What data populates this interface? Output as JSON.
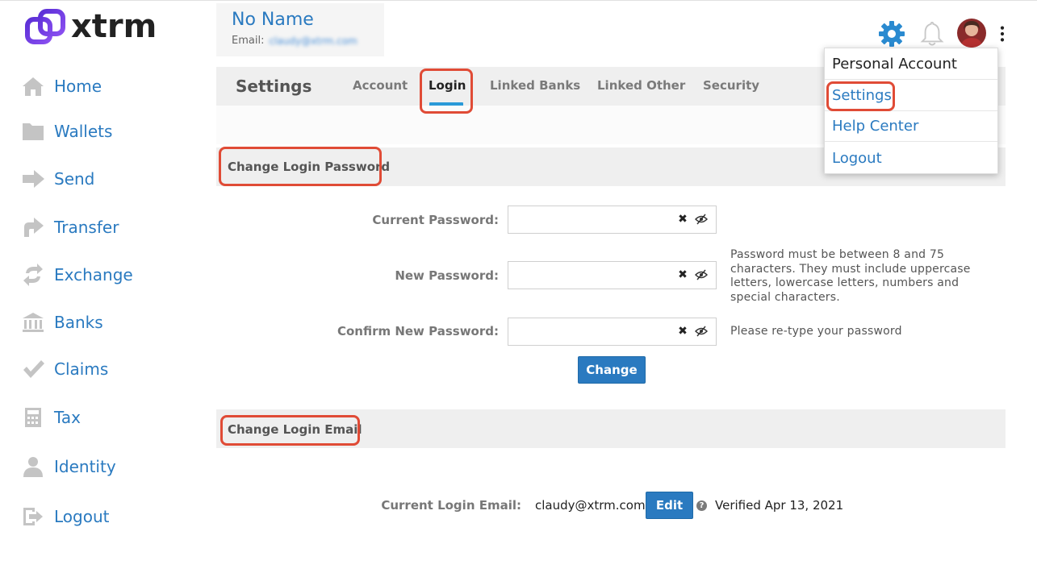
{
  "brand": {
    "logo_text": "xtrm",
    "colors": {
      "accent": "#2a7ac0",
      "logo_purple": "#6a3de8",
      "highlight": "#e04b36",
      "tab_underline": "#2a9ad8"
    }
  },
  "sidebar": {
    "items": [
      {
        "label": "Home",
        "icon": "home-icon"
      },
      {
        "label": "Wallets",
        "icon": "folder-icon"
      },
      {
        "label": "Send",
        "icon": "arrow-right-icon"
      },
      {
        "label": "Transfer",
        "icon": "transfer-icon"
      },
      {
        "label": "Exchange",
        "icon": "exchange-icon"
      },
      {
        "label": "Banks",
        "icon": "bank-icon"
      },
      {
        "label": "Claims",
        "icon": "checkmark-icon"
      },
      {
        "label": "Tax",
        "icon": "calculator-icon"
      },
      {
        "label": "Identity",
        "icon": "person-icon"
      },
      {
        "label": "Logout",
        "icon": "logout-icon"
      }
    ]
  },
  "profile": {
    "name": "No Name",
    "email_label": "Email:",
    "email_value": "claudy@xtrm.com"
  },
  "header": {
    "icons": [
      "gear-icon",
      "bell-icon",
      "avatar",
      "kebab-menu-icon"
    ]
  },
  "settings": {
    "title": "Settings",
    "tabs": [
      {
        "label": "Account",
        "active": false
      },
      {
        "label": "Login",
        "active": true
      },
      {
        "label": "Linked Banks",
        "active": false
      },
      {
        "label": "Linked Other",
        "active": false
      },
      {
        "label": "Security",
        "active": false
      }
    ]
  },
  "password_section": {
    "title": "Change Login Password",
    "current_label": "Current Password:",
    "new_label": "New Password:",
    "confirm_label": "Confirm New Password:",
    "clear_glyph": "✖",
    "new_hint": "Password must be between 8 and 75 characters. They must include uppercase letters, lowercase letters, numbers and special characters.",
    "confirm_hint": "Please re-type your password",
    "button": "Change"
  },
  "email_section": {
    "title": "Change Login Email",
    "current_label": "Current Login Email:",
    "current_value": "claudy@xtrm.com",
    "edit_button": "Edit",
    "help_glyph": "?",
    "verified_text": "Verified Apr 13, 2021"
  },
  "dropdown": {
    "header": "Personal Account",
    "items": [
      "Settings",
      "Help Center",
      "Logout"
    ]
  }
}
